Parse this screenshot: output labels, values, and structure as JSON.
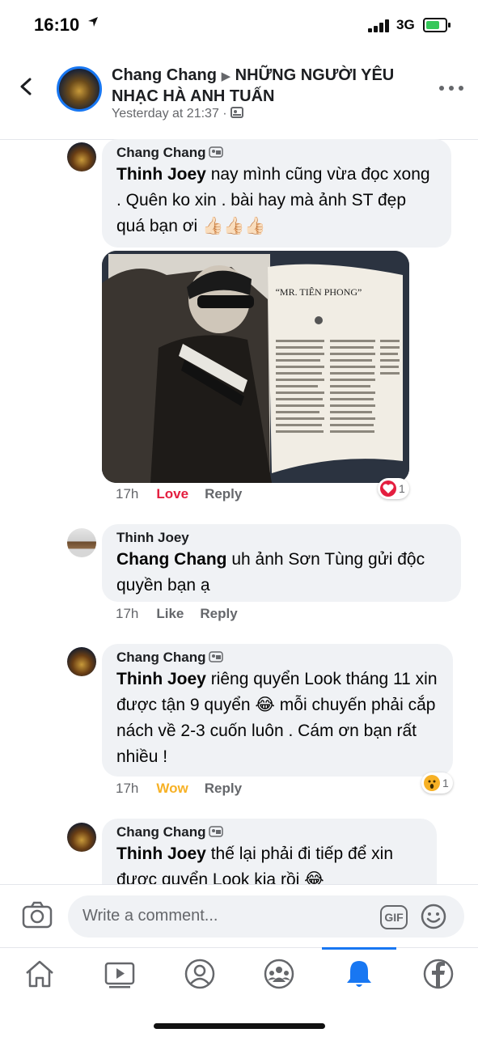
{
  "status_bar": {
    "time": "16:10",
    "network": "3G"
  },
  "header": {
    "author": "Chang Chang",
    "group": "NHỮNG NGƯỜI YÊU NHẠC HÀ ANH TUẤN",
    "timestamp": "Yesterday at 21:37 ·"
  },
  "comments": [
    {
      "author": "Chang Chang",
      "mention": "Thinh Joey",
      "text": " nay mình cũng vừa đọc xong . Quên ko xin . bài hay mà ảnh ST đẹp quá bạn ơi",
      "emoji": "👍🏻👍🏻👍🏻",
      "time": "17h",
      "reaction_label": "Love",
      "reply_label": "Reply",
      "reaction_count": "1",
      "photo_headline": "“MR. TIÊN PHONG”"
    },
    {
      "author": "Thinh Joey",
      "mention": "Chang Chang",
      "text": " uh ảnh Sơn Tùng gửi độc quyền bạn ạ",
      "time": "17h",
      "reaction_label": "Like",
      "reply_label": "Reply"
    },
    {
      "author": "Chang Chang",
      "mention": "Thinh Joey",
      "text": " riêng quyển Look tháng 11 xin được tận 9 quyển 😂 mỗi chuyến phải cắp nách về 2-3 cuốn luôn . Cám ơn bạn rất nhiều !",
      "time": "17h",
      "reaction_label": "Wow",
      "reply_label": "Reply",
      "reaction_count": "1"
    },
    {
      "author": "Chang Chang",
      "mention": "Thinh Joey",
      "text": " thế lại phải đi tiếp để xin được quyển Look kia rồi 😂"
    }
  ],
  "composer": {
    "placeholder": "Write a comment...",
    "gif_label": "GIF"
  },
  "colors": {
    "accent": "#1877f2",
    "love": "#e41e3f",
    "wow": "#f7b125",
    "bubble": "#f0f2f5"
  }
}
